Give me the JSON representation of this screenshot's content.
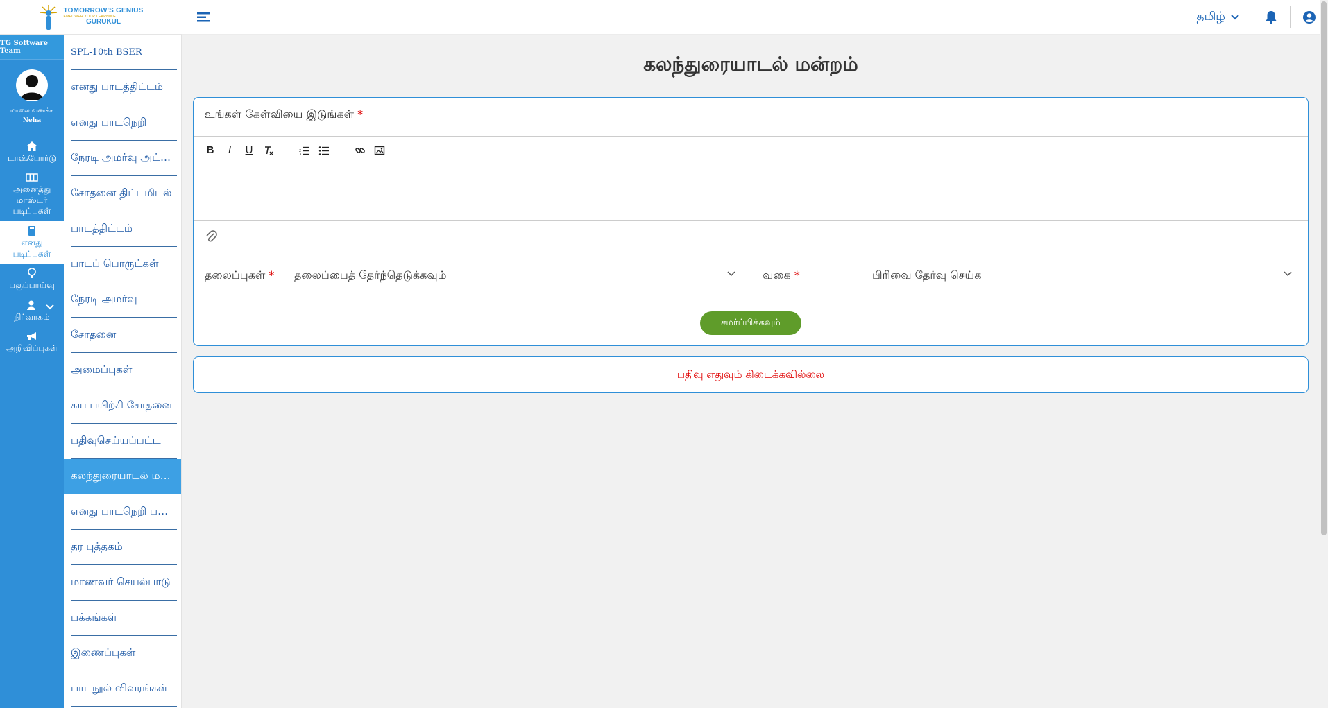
{
  "brand": {
    "line1": "TOMORROW'S GENIUS",
    "line2": "EMPOWER YOUR LEARNING",
    "line3": "GURUKUL",
    "colors": {
      "blue": "#2f8fd8",
      "gold": "#d4a200"
    }
  },
  "header": {
    "language": "தமிழ்",
    "icons": [
      "menu-icon",
      "chevron-down-icon",
      "bell-icon",
      "user-circle-icon"
    ]
  },
  "rail": {
    "team": "TG Software Team",
    "greeting": "மாலை வணக்க",
    "user_name": "Neha",
    "items": [
      {
        "label": "டாஷ்போர்டு",
        "icon": "home-icon"
      },
      {
        "label": "அனைத்து மாஸ்டர் படிப்புகள்",
        "icon": "grid-icon"
      },
      {
        "label": "எனது படிப்புகள்",
        "icon": "book-icon",
        "active": true
      },
      {
        "label": "பகுப்பாய்வு",
        "icon": "bulb-icon"
      },
      {
        "label": "நிர்வாகம்",
        "icon": "admin-icon"
      },
      {
        "label": "அறிவிப்புகள்",
        "icon": "megaphone-icon"
      }
    ]
  },
  "submenu": {
    "items": [
      "SPL-10th BSER",
      "எனது பாடத்திட்டம்",
      "எனது பாடநெறி",
      "நேரடி அமர்வு அட்டவணை",
      "சோதனை திட்டமிடல்",
      "பாடத்திட்டம்",
      "பாடப் பொருட்கள்",
      "நேரடி அமர்வு",
      "சோதனை",
      "அமைப்புகள்",
      "சுய பயிற்சி சோதனை",
      "பதிவுசெய்யப்பட்ட",
      "கலந்துரையாடல் மன்றம்",
      "எனது பாடநெறி பகுப்பாய்வு",
      "தர புத்தகம்",
      "மாணவர் செயல்பாடு",
      "பக்கங்கள்",
      "இணைப்புகள்",
      "பாடநூல் விவரங்கள்"
    ],
    "active_index": 12
  },
  "main": {
    "title": "கலந்துரையாடல் மன்றம்",
    "question_label": "உங்கள் கேள்வியை இடுங்கள்",
    "required_mark": "*",
    "editor_tools": [
      "B",
      "I",
      "U",
      "Tx",
      "ordered-list-icon",
      "bullet-list-icon",
      "link-icon",
      "image-icon"
    ],
    "topics_label": "தலைப்புகள்",
    "topics_placeholder": "தலைப்பைத் தேர்ந்தெடுக்கவும்",
    "category_label": "வகை",
    "category_placeholder": "பிரிவை தேர்வு செய்க",
    "submit_label": "சமர்ப்பிக்கவும்",
    "no_records": "பதிவு எதுவும் கிடைக்கவில்லை",
    "colors": {
      "submit": "#5f9c2a",
      "error": "#e00000",
      "border": "#2f8fd8"
    }
  }
}
